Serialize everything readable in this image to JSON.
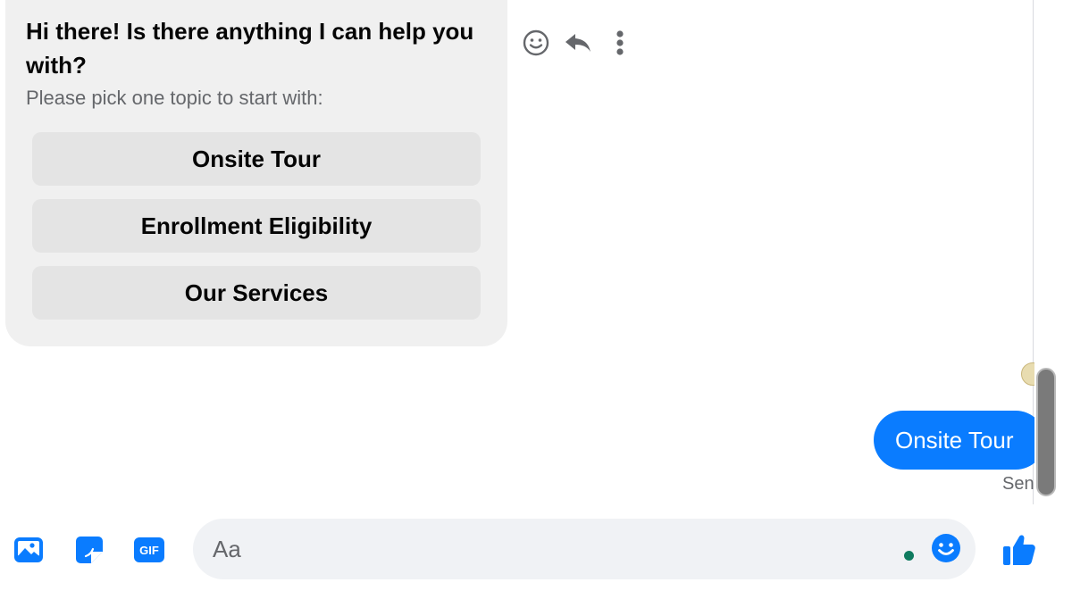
{
  "bot_message": {
    "title": "Hi there! Is there anything I can help you with?",
    "subtitle": "Please pick one topic to start with:",
    "topics": [
      "Onsite Tour",
      "Enrollment Eligibility",
      "Our Services"
    ]
  },
  "message_actions": {
    "icons": [
      "react-icon",
      "reply-icon",
      "more-icon"
    ]
  },
  "user_message": {
    "text": "Onsite Tour",
    "status": "Sent"
  },
  "composer": {
    "placeholder": "Aa",
    "tools": [
      "photo-icon",
      "sticker-icon",
      "gif-icon"
    ],
    "gif_label": "GIF",
    "send_icon": "like-icon"
  },
  "colors": {
    "accent": "#0a7cff",
    "bubble_gray": "#f0f0f0",
    "topic_button": "#e4e4e4",
    "online_dot": "#0f7b5f"
  }
}
